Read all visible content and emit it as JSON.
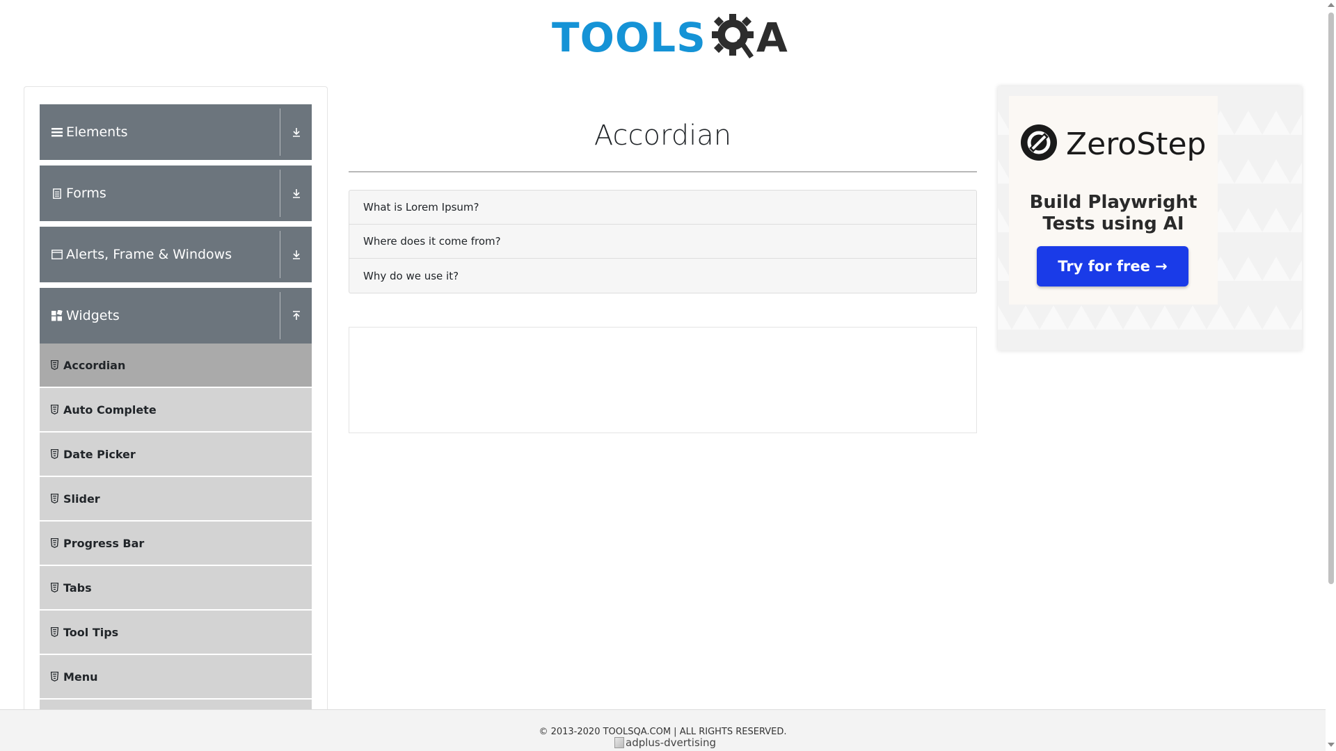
{
  "logo": {
    "part1": "TOOLS",
    "part2": "A",
    "alt": "ToolsQA"
  },
  "nav": {
    "groups": [
      {
        "label": "Elements",
        "icon": "hamburger-icon",
        "state": "collapsed"
      },
      {
        "label": "Forms",
        "icon": "document-icon",
        "state": "collapsed"
      },
      {
        "label": "Alerts, Frame & Windows",
        "icon": "window-icon",
        "state": "collapsed"
      },
      {
        "label": "Widgets",
        "icon": "widgets-icon",
        "state": "expanded"
      }
    ],
    "widgets_items": [
      {
        "label": "Accordian",
        "active": true
      },
      {
        "label": "Auto Complete"
      },
      {
        "label": "Date Picker"
      },
      {
        "label": "Slider"
      },
      {
        "label": "Progress Bar"
      },
      {
        "label": "Tabs"
      },
      {
        "label": "Tool Tips"
      },
      {
        "label": "Menu"
      }
    ]
  },
  "main": {
    "title": "Accordian",
    "sections": [
      {
        "heading": "What is Lorem Ipsum?"
      },
      {
        "heading": "Where does it come from?"
      },
      {
        "heading": "Why do we use it?"
      }
    ]
  },
  "side_ad": {
    "brand": "ZeroStep",
    "tagline_line1": "Build Playwright",
    "tagline_line2": "Tests using AI",
    "cta": "Try for free →",
    "accent_color": "#1a3be8"
  },
  "footer": {
    "copyright": "© 2013-2020 TOOLSQA.COM | ALL RIGHTS RESERVED.",
    "ad_alt": "adplus-dvertising"
  },
  "colors": {
    "nav_header": "#6c757d",
    "nav_item": "#d3d3d3",
    "nav_item_active": "#aaaaaa",
    "logo_blue": "#1593d6"
  }
}
